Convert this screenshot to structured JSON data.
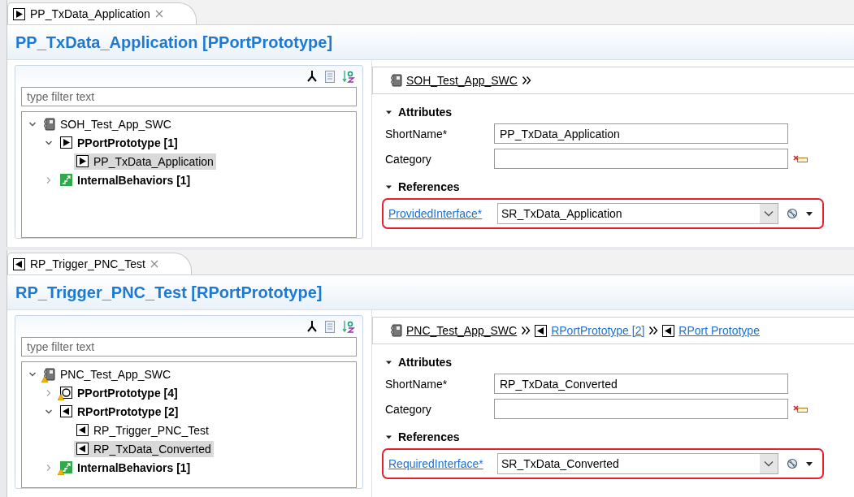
{
  "editors": [
    {
      "tab": {
        "label": "PP_TxData_Application",
        "kind": "pport",
        "selected": true
      },
      "title": "PP_TxData_Application [PPortPrototype]",
      "filter": {
        "placeholder": "type filter text"
      },
      "tree": [
        {
          "label": "SOH_Test_App_SWC",
          "kind": "component",
          "warning": false,
          "bold": false,
          "selected": false,
          "expanded": true,
          "children": [
            {
              "label": "PPortPrototype [1]",
              "kind": "pport",
              "warning": false,
              "bold": true,
              "selected": false,
              "expanded": true,
              "children": [
                {
                  "label": "PP_TxData_Application",
                  "kind": "pport",
                  "warning": false,
                  "bold": false,
                  "selected": true
                }
              ]
            },
            {
              "label": "InternalBehaviors [1]",
              "kind": "behavior",
              "warning": false,
              "bold": true,
              "selected": false,
              "expanded": false
            }
          ]
        }
      ],
      "breadcrumb": [
        {
          "label": "SOH_Test_App_SWC",
          "kind": "component"
        }
      ],
      "attributes": {
        "heading": "Attributes",
        "expanded": true,
        "fields": [
          {
            "label": "ShortName*",
            "value": "PP_TxData_Application",
            "clearable": false
          },
          {
            "label": "Category",
            "clearable": true
          }
        ]
      },
      "references": {
        "heading": "References",
        "expanded": true,
        "items": [
          {
            "label": "ProvidedInterface*",
            "value": "SR_TxData_Application",
            "highlighted": true
          }
        ]
      }
    },
    {
      "tab": {
        "label": "RP_Trigger_PNC_Test",
        "kind": "rport",
        "selected": true
      },
      "title": "RP_Trigger_PNC_Test [RPortPrototype]",
      "filter": {
        "placeholder": "type filter text"
      },
      "tree": [
        {
          "label": "PNC_Test_App_SWC",
          "kind": "component",
          "warning": true,
          "bold": false,
          "selected": false,
          "expanded": true,
          "children": [
            {
              "label": "PPortPrototype [4]",
              "kind": "pport-multi",
              "warning": true,
              "bold": true,
              "selected": false,
              "expanded": false
            },
            {
              "label": "RPortPrototype [2]",
              "kind": "rport",
              "warning": false,
              "bold": true,
              "selected": false,
              "expanded": true,
              "children": [
                {
                  "label": "RP_Trigger_PNC_Test",
                  "kind": "rport",
                  "warning": false,
                  "bold": false,
                  "selected": false
                },
                {
                  "label": "RP_TxData_Converted",
                  "kind": "rport",
                  "warning": false,
                  "bold": false,
                  "selected": true
                }
              ]
            },
            {
              "label": "InternalBehaviors [1]",
              "kind": "behavior",
              "warning": true,
              "bold": true,
              "selected": false,
              "expanded": false
            }
          ]
        }
      ],
      "breadcrumb": [
        {
          "label": "PNC_Test_App_SWC",
          "kind": "component"
        },
        {
          "label": "RPortPrototype [2]",
          "kind": "rport"
        },
        {
          "label": "RPort Prototype",
          "kind": "rport"
        }
      ],
      "attributes": {
        "heading": "Attributes",
        "expanded": true,
        "fields": [
          {
            "label": "ShortName*",
            "value": "RP_TxData_Converted",
            "clearable": false
          },
          {
            "label": "Category",
            "clearable": true
          }
        ]
      },
      "references": {
        "heading": "References",
        "expanded": true,
        "items": [
          {
            "label": "RequiredInterface*",
            "value": "SR_TxData_Converted",
            "highlighted": true
          }
        ]
      }
    }
  ]
}
